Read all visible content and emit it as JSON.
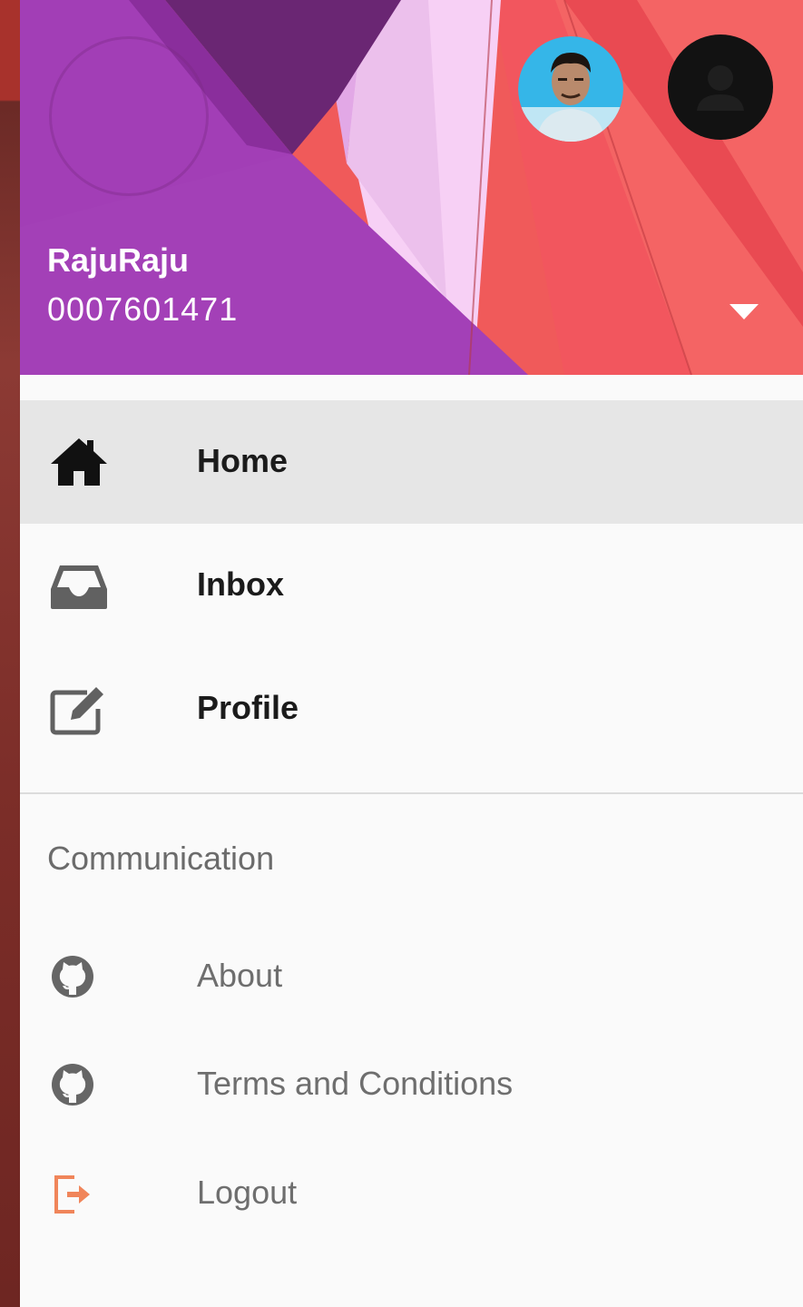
{
  "account": {
    "name": "RajuRaju",
    "number": "0007601471"
  },
  "menu": {
    "items": [
      {
        "label": "Home",
        "icon": "home-icon",
        "selected": true
      },
      {
        "label": "Inbox",
        "icon": "inbox-icon",
        "selected": false
      },
      {
        "label": "Profile",
        "icon": "edit-icon",
        "selected": false
      }
    ]
  },
  "communication": {
    "title": "Communication",
    "items": [
      {
        "label": "About",
        "icon": "github-icon"
      },
      {
        "label": "Terms and Conditions",
        "icon": "github-icon"
      },
      {
        "label": "Logout",
        "icon": "logout-icon"
      }
    ]
  },
  "colors": {
    "header_purple": "#9c3fb0",
    "header_red": "#f05a5a",
    "selected_bg": "#e6e6e6",
    "logout_icon": "#f0855a"
  }
}
